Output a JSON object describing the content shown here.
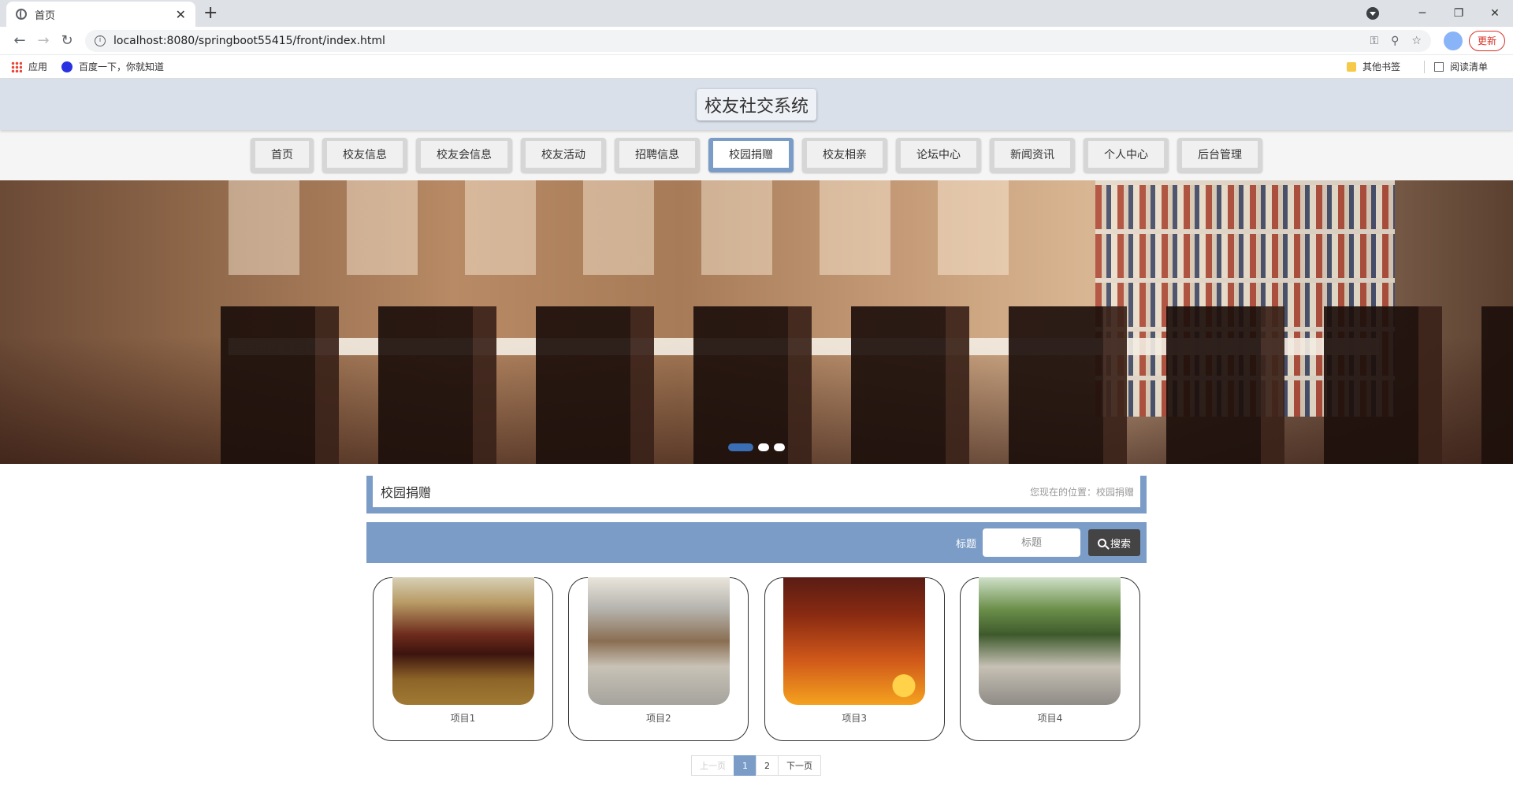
{
  "browser": {
    "tab_title": "首页",
    "url": "localhost:8080/springboot55415/front/index.html",
    "update_label": "更新",
    "bookmarks": [
      "应用",
      "百度一下，你就知道"
    ],
    "bookmarks_right": [
      "其他书签",
      "阅读清单"
    ]
  },
  "site": {
    "title": "校友社交系统"
  },
  "nav": {
    "items": [
      "首页",
      "校友信息",
      "校友会信息",
      "校友活动",
      "招聘信息",
      "校园捐赠",
      "校友相亲",
      "论坛中心",
      "新闻资讯",
      "个人中心",
      "后台管理"
    ],
    "active": "校园捐赠"
  },
  "banner": {
    "slide_count": 3,
    "active_slide": 1
  },
  "section": {
    "title": "校园捐赠",
    "location": "您现在的位置：校园捐赠"
  },
  "search": {
    "label": "标题",
    "placeholder": "标题",
    "button": "搜索"
  },
  "items": [
    "项目1",
    "项目2",
    "项目3",
    "项目4"
  ],
  "pager": {
    "prev": "上一页",
    "pages": [
      "1",
      "2"
    ],
    "current": "1",
    "next": "下一页"
  },
  "colors": {
    "accent": "#7a9cc6",
    "header_bg": "#d9e0ea",
    "dot_active": "#3a6fb5"
  }
}
